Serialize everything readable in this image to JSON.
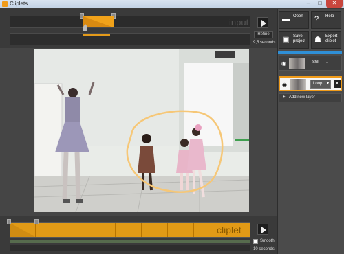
{
  "window": {
    "title": "Cliplets",
    "controls": {
      "minimize": "–",
      "maximize": "□",
      "close": "✕"
    }
  },
  "input_timeline": {
    "label": "input",
    "refine_label": "Refine",
    "duration": "9,5 seconds"
  },
  "toolbar": {
    "open_label": "Open",
    "help_label": "Help",
    "save_label": "Save\nproject",
    "export_label": "Export\ncliplet"
  },
  "layers": [
    {
      "name": "still-layer",
      "type_label": "Still",
      "visible": true
    },
    {
      "name": "loop-layer",
      "type_label": "Loop",
      "visible": true,
      "selected": true
    }
  ],
  "add_layer_label": "Add new layer",
  "cliplet_timeline": {
    "label": "cliplet",
    "smooth_label": "Smooth",
    "smooth_checked": false,
    "duration": "10 seconds"
  },
  "icons": {
    "play": "play-icon",
    "open": "folder-icon",
    "help": "question-icon",
    "save": "disk-icon",
    "export": "people-icon",
    "eye": "eye-icon",
    "delete": "delete-icon",
    "add": "plus-icon"
  },
  "colors": {
    "accent": "#f09b1a",
    "selection": "#2f8fd6",
    "mask_outline": "#f6c777"
  }
}
